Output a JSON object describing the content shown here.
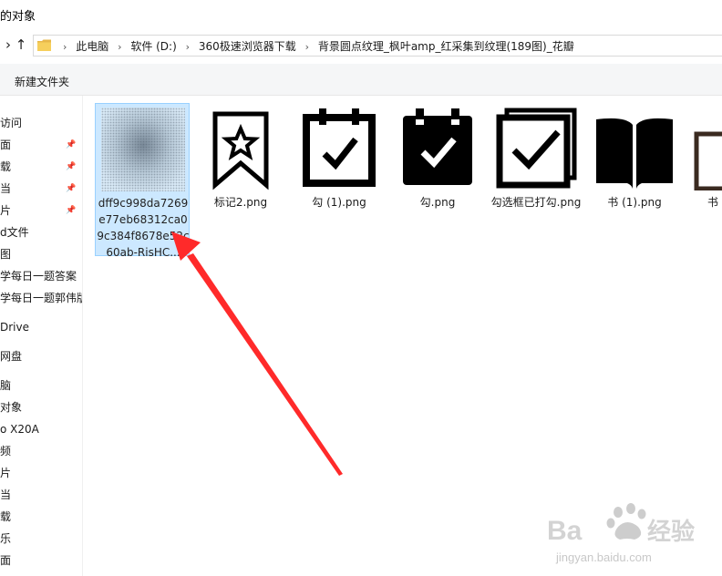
{
  "window": {
    "title": "的对象"
  },
  "address": {
    "crumbs": [
      "此电脑",
      "软件 (D:)",
      "360极速浏览器下载",
      "背景圆点纹理_枫叶amp_红采集到纹理(189图)_花瓣"
    ]
  },
  "toolbar": {
    "new_folder": "新建文件夹"
  },
  "nav": {
    "items": [
      {
        "label": "访问",
        "pinned": false
      },
      {
        "label": "面",
        "pinned": true
      },
      {
        "label": "载",
        "pinned": true
      },
      {
        "label": "当",
        "pinned": true
      },
      {
        "label": "片",
        "pinned": true
      },
      {
        "label": "d文件",
        "pinned": false
      },
      {
        "label": "图",
        "pinned": false
      },
      {
        "label": "学每日一题答案",
        "pinned": false
      },
      {
        "label": "学每日一题郭伟版",
        "pinned": false
      },
      {
        "label": "Drive",
        "pinned": false
      },
      {
        "label": "网盘",
        "pinned": false
      },
      {
        "label": "脑",
        "pinned": false
      },
      {
        "label": " 对象",
        "pinned": false
      },
      {
        "label": "o X20A",
        "pinned": false
      },
      {
        "label": "频",
        "pinned": false
      },
      {
        "label": "片",
        "pinned": false
      },
      {
        "label": "当",
        "pinned": false
      },
      {
        "label": "载",
        "pinned": false
      },
      {
        "label": "乐",
        "pinned": false
      },
      {
        "label": "面",
        "pinned": false
      }
    ]
  },
  "files": [
    {
      "name": "dff9c998da7269e77eb68312ca09c384f8678e52c60ab-RisHC...",
      "icon": "dot-texture-thumb",
      "selected": true
    },
    {
      "name": "标记2.png",
      "icon": "bookmark-star-icon",
      "selected": false
    },
    {
      "name": "勾 (1).png",
      "icon": "calendar-check-outline-icon",
      "selected": false
    },
    {
      "name": "勾.png",
      "icon": "calendar-check-filled-icon",
      "selected": false
    },
    {
      "name": "勾选框已打勾.png",
      "icon": "checkbox-checked-icon",
      "selected": false
    },
    {
      "name": "书 (1).png",
      "icon": "open-book-icon",
      "selected": false
    },
    {
      "name": "书",
      "icon": "book-outline-icon",
      "selected": false
    }
  ],
  "annotation": {
    "color": "#ff2a2a"
  },
  "watermark": {
    "brand": "Baidu经验",
    "url": "jingyan.baidu.com"
  }
}
